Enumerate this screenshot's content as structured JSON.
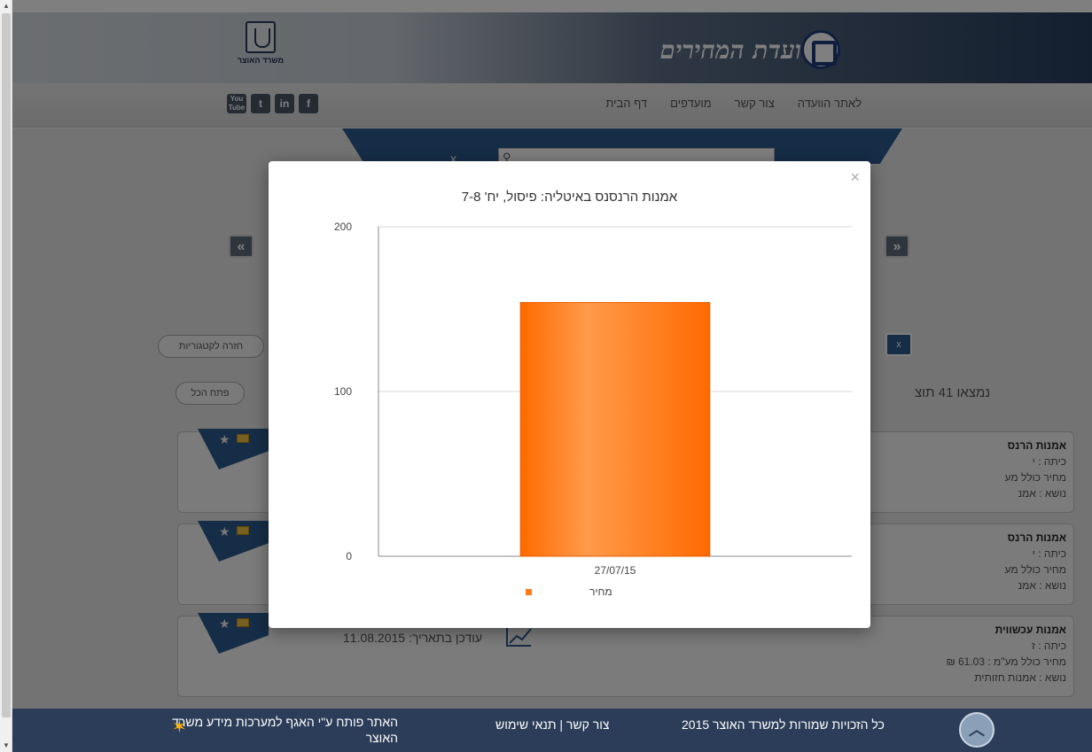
{
  "site": {
    "brand": "ועדת המחירים",
    "ministry": "משרד האוצר"
  },
  "nav": {
    "items": [
      "דף הבית",
      "מועדפים",
      "צור קשר",
      "לאתר הוועדה"
    ]
  },
  "social": [
    "YouTube",
    "t",
    "in",
    "f"
  ],
  "search": {
    "clear_label": "x"
  },
  "carousel": {
    "prev": "«",
    "next": "»"
  },
  "buttons": {
    "back_to_categories": "חזרה לקטגוריות",
    "open_all": "פתח הכל",
    "filter_chip": "x"
  },
  "results": {
    "count_text": "נמצאו 41 תוצ"
  },
  "items": [
    {
      "title": "אמנות הרנס",
      "grade": "כיתה : י",
      "price": "מחיר כולל מע",
      "subject": "נושא : אמנ",
      "updated": ""
    },
    {
      "title": "אמנות הרנס",
      "grade": "כיתה : י",
      "price": "מחיר כולל מע",
      "subject": "נושא : אמנ",
      "updated": ""
    },
    {
      "title": "אמנות עכשווית",
      "grade": "כיתה : ז",
      "price": "מחיר כולל מע\"מ : 61.03 ₪",
      "subject": "נושא : אמנות חזותית",
      "updated": "עודכן בתאריך: 11.08.2015"
    }
  ],
  "footer": {
    "copyright": "כל הזכויות שמורות למשרד האוצר 2015",
    "links": "צור קשר | תנאי שימוש",
    "credit": "האתר פותח ע\"י האגף למערכות מידע משרד האוצר"
  },
  "modal": {
    "close_label": "×",
    "title": "אמנות הרנסנס באיטליה: פיסול, יח' 7-8"
  },
  "chart_data": {
    "type": "bar",
    "title": "אמנות הרנסנס באיטליה: פיסול, יח' 7-8",
    "categories": [
      "27/07/15"
    ],
    "series": [
      {
        "name": "מחיר",
        "values": [
          154
        ]
      }
    ],
    "yticks": [
      "0",
      "100",
      "200"
    ],
    "ylim": [
      0,
      200
    ],
    "xlabel": "",
    "ylabel": "",
    "grid": true,
    "legend": "bottom",
    "bar_color": "#ff7a1a"
  }
}
